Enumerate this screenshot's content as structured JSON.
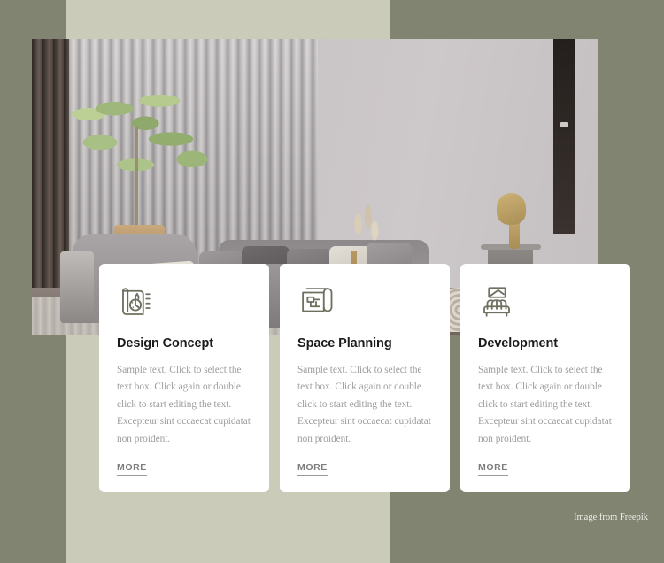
{
  "theme": {
    "outer_background": "#828472",
    "panel_background": "#cbcbb9",
    "card_background": "#ffffff",
    "icon_color": "#6e7060",
    "title_color": "#1c1c1c",
    "body_text_color": "#9c9c9c",
    "link_color": "#7d7d7d"
  },
  "hero": {
    "alt": "Modern living room interior with slatted wall, olive tree, grey sofa and gold table lamp"
  },
  "cards": [
    {
      "icon": "design-concept-icon",
      "title": "Design Concept",
      "body": "Sample text. Click to select the text box. Click again or double click to start editing the text. Excepteur sint occaecat cupidatat non proident.",
      "link_label": "MORE"
    },
    {
      "icon": "floor-plan-icon",
      "title": "Space Planning",
      "body": "Sample text. Click to select the text box. Click again or double click to start editing the text. Excepteur sint occaecat cupidatat non proident.",
      "link_label": "MORE"
    },
    {
      "icon": "sofa-icon",
      "title": "Development",
      "body": "Sample text. Click to select the text box. Click again or double click to start editing the text. Excepteur sint occaecat cupidatat non proident.",
      "link_label": "MORE"
    }
  ],
  "attribution": {
    "prefix": "Image from ",
    "link_label": "Freepik"
  }
}
